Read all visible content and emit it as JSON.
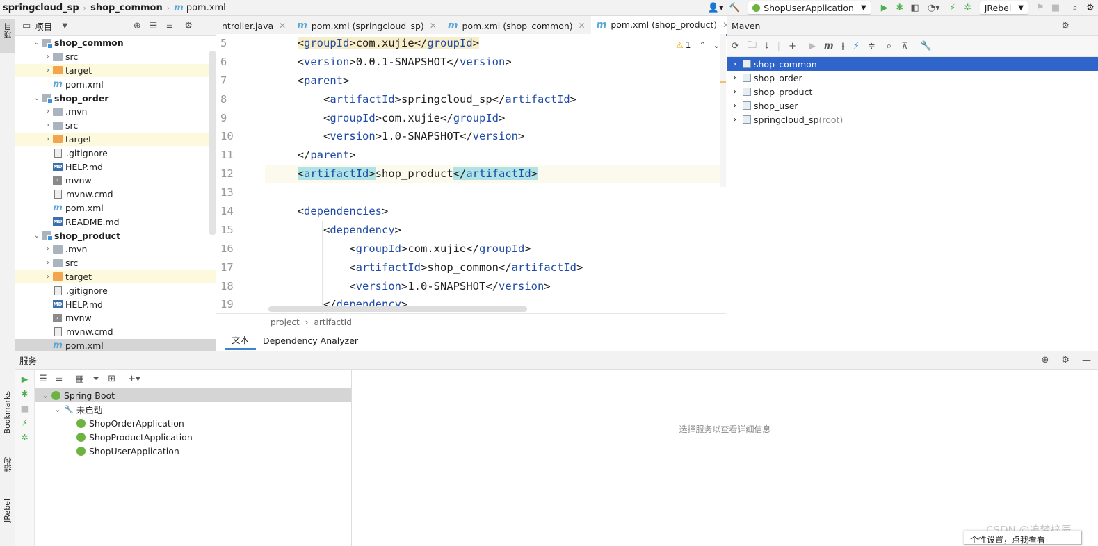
{
  "breadcrumb": {
    "root": "springcloud_sp",
    "module": "shop_common",
    "file": "pom.xml"
  },
  "toolbar": {
    "run_config": "ShopUserApplication",
    "jrebel": "JRebel"
  },
  "left_strip": {
    "project": "项目",
    "bookmarks": "Bookmarks",
    "structure": "结构",
    "jrebel": "JRebel"
  },
  "project_panel": {
    "title": "项目",
    "rows": [
      {
        "label": "shop_common",
        "type": "module",
        "bold": true,
        "arrow": "down",
        "level": 0
      },
      {
        "label": "src",
        "type": "folder",
        "arrow": "right",
        "level": 1
      },
      {
        "label": "target",
        "type": "folder-orange",
        "arrow": "right",
        "level": 1,
        "hl": true
      },
      {
        "label": "pom.xml",
        "type": "maven",
        "arrow": "",
        "level": 1
      },
      {
        "label": "shop_order",
        "type": "module",
        "bold": true,
        "arrow": "down",
        "level": 0
      },
      {
        "label": ".mvn",
        "type": "folder",
        "arrow": "right",
        "level": 1
      },
      {
        "label": "src",
        "type": "folder",
        "arrow": "right",
        "level": 1
      },
      {
        "label": "target",
        "type": "folder-orange",
        "arrow": "right",
        "level": 1,
        "hl": true
      },
      {
        "label": ".gitignore",
        "type": "file",
        "arrow": "",
        "level": 1
      },
      {
        "label": "HELP.md",
        "type": "md",
        "arrow": "",
        "level": 1
      },
      {
        "label": "mvnw",
        "type": "term",
        "arrow": "",
        "level": 1
      },
      {
        "label": "mvnw.cmd",
        "type": "file",
        "arrow": "",
        "level": 1
      },
      {
        "label": "pom.xml",
        "type": "maven",
        "arrow": "",
        "level": 1
      },
      {
        "label": "README.md",
        "type": "md",
        "arrow": "",
        "level": 1
      },
      {
        "label": "shop_product",
        "type": "module",
        "bold": true,
        "arrow": "down",
        "level": 0
      },
      {
        "label": ".mvn",
        "type": "folder",
        "arrow": "right",
        "level": 1
      },
      {
        "label": "src",
        "type": "folder",
        "arrow": "right",
        "level": 1
      },
      {
        "label": "target",
        "type": "folder-orange",
        "arrow": "right",
        "level": 1,
        "hl": true
      },
      {
        "label": ".gitignore",
        "type": "file",
        "arrow": "",
        "level": 1
      },
      {
        "label": "HELP.md",
        "type": "md",
        "arrow": "",
        "level": 1
      },
      {
        "label": "mvnw",
        "type": "term",
        "arrow": "",
        "level": 1
      },
      {
        "label": "mvnw.cmd",
        "type": "file",
        "arrow": "",
        "level": 1
      },
      {
        "label": "pom.xml",
        "type": "maven",
        "arrow": "",
        "level": 1,
        "sel": true
      }
    ]
  },
  "editor": {
    "tabs": [
      {
        "label": "ntroller.java",
        "icon": false,
        "active": false
      },
      {
        "label": "pom.xml (springcloud_sp)",
        "icon": true,
        "active": false
      },
      {
        "label": "pom.xml (shop_common)",
        "icon": true,
        "active": false
      },
      {
        "label": "pom.xml (shop_product)",
        "icon": true,
        "active": true
      }
    ],
    "warning_count": "1",
    "line_numbers": [
      "5",
      "6",
      "7",
      "8",
      "9",
      "10",
      "11",
      "12",
      "13",
      "14",
      "15",
      "16",
      "17",
      "18",
      "19"
    ],
    "lines": [
      {
        "indent": "    ",
        "open": "groupId",
        "text": "com.xujie",
        "close": "groupId",
        "style": "hl1"
      },
      {
        "indent": "    ",
        "open": "version",
        "text": "0.0.1-SNAPSHOT",
        "close": "version"
      },
      {
        "indent": "    ",
        "open": "parent",
        "text": "",
        "close": ""
      },
      {
        "indent": "        ",
        "open": "artifactId",
        "text": "springcloud_sp",
        "close": "artifactId"
      },
      {
        "indent": "        ",
        "open": "groupId",
        "text": "com.xujie",
        "close": "groupId"
      },
      {
        "indent": "        ",
        "open": "version",
        "text": "1.0-SNAPSHOT",
        "close": "version"
      },
      {
        "indent": "    ",
        "open": "",
        "text": "",
        "close": "parent"
      },
      {
        "indent": "    ",
        "open": "artifactId",
        "text": "shop_product",
        "close": "artifactId",
        "style": "hl2",
        "cur": true
      },
      {
        "indent": "",
        "open": "",
        "text": "",
        "close": ""
      },
      {
        "indent": "    ",
        "open": "dependencies",
        "text": "",
        "close": ""
      },
      {
        "indent": "        ",
        "open": "dependency",
        "text": "",
        "close": ""
      },
      {
        "indent": "            ",
        "open": "groupId",
        "text": "com.xujie",
        "close": "groupId"
      },
      {
        "indent": "            ",
        "open": "artifactId",
        "text": "shop_common",
        "close": "artifactId"
      },
      {
        "indent": "            ",
        "open": "version",
        "text": "1.0-SNAPSHOT",
        "close": "version"
      },
      {
        "indent": "        ",
        "open": "",
        "text": "",
        "close": "dependency"
      }
    ],
    "status_path": [
      "project",
      "artifactId"
    ],
    "bottom_tabs": [
      "文本",
      "Dependency Analyzer"
    ]
  },
  "maven": {
    "title": "Maven",
    "projects": [
      {
        "label": "shop_common",
        "suffix": "",
        "sel": true
      },
      {
        "label": "shop_order",
        "suffix": ""
      },
      {
        "label": "shop_product",
        "suffix": ""
      },
      {
        "label": "shop_user",
        "suffix": ""
      },
      {
        "label": "springcloud_sp",
        "suffix": " (root)"
      }
    ]
  },
  "services": {
    "title": "服务",
    "tree": [
      {
        "label": "Spring Boot",
        "level": 0,
        "icon": "boot",
        "arrow": "down",
        "group": true
      },
      {
        "label": "未启动",
        "level": 1,
        "icon": "wrench",
        "arrow": "down"
      },
      {
        "label": "ShopOrderApplication",
        "level": 2,
        "icon": "boot"
      },
      {
        "label": "ShopProductApplication",
        "level": 2,
        "icon": "boot"
      },
      {
        "label": "ShopUserApplication",
        "level": 2,
        "icon": "boot"
      }
    ],
    "detail_placeholder": "选择服务以查看详细信息"
  },
  "watermark": "CSDN @追梦梓辰",
  "popup_text": "个性设置，点我看看",
  "colors": {
    "accent": "#2f65ca",
    "tag": "#1f4aa5",
    "highlight_row": "#fdf9dc",
    "folder_excluded": "#f3a44f"
  }
}
